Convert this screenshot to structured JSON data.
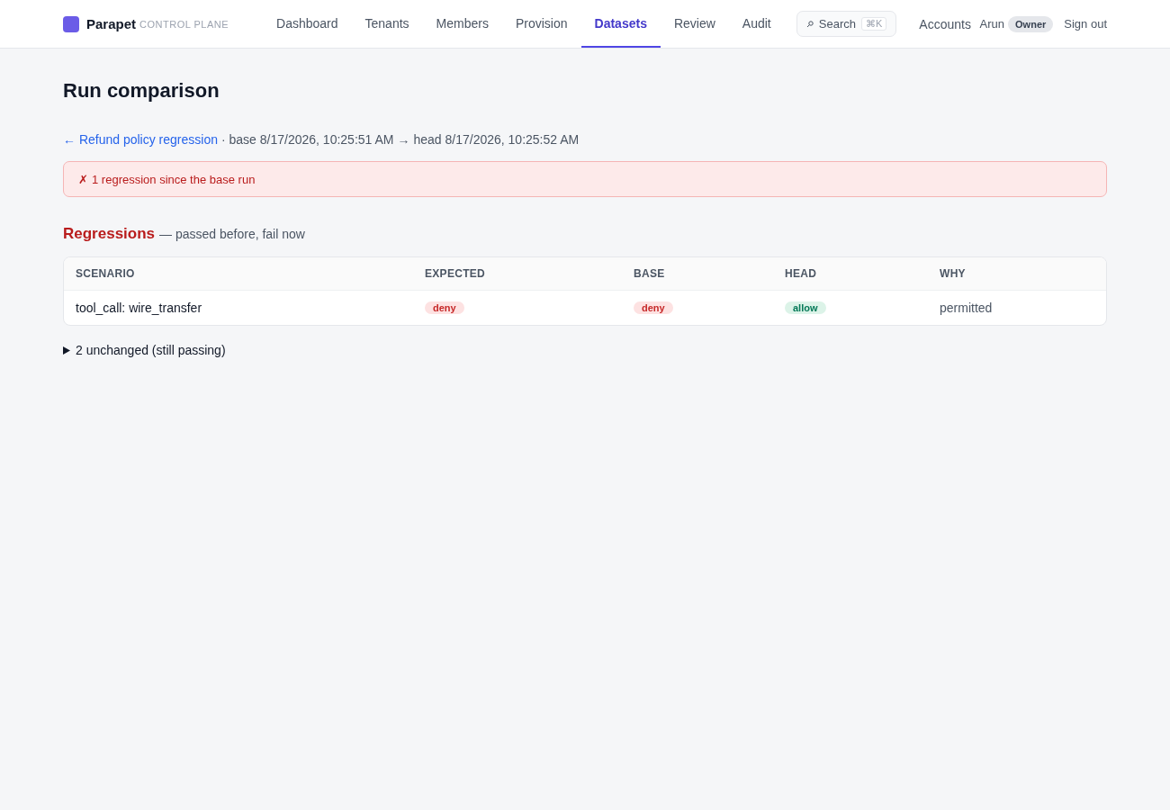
{
  "brand": {
    "name": "Parapet",
    "subtitle": "CONTROL PLANE"
  },
  "nav": [
    {
      "label": "Dashboard",
      "selected": false
    },
    {
      "label": "Tenants",
      "selected": false
    },
    {
      "label": "Members",
      "selected": false
    },
    {
      "label": "Provision",
      "selected": false
    },
    {
      "label": "Datasets",
      "selected": true
    },
    {
      "label": "Review",
      "selected": false
    },
    {
      "label": "Audit",
      "selected": false
    }
  ],
  "search": {
    "placeholder": "Search",
    "shortcut": "⌘K"
  },
  "accounts_link": "Accounts",
  "user": {
    "name": "Arun",
    "role": "Owner"
  },
  "sign_out": "Sign out",
  "page_title": "Run comparison",
  "breadcrumb": {
    "back_link": "← Refund policy regression",
    "base": "· base 8/17/2026, 10:25:51 AM",
    "arrow": "→",
    "head": "head 8/17/2026, 10:25:52 AM"
  },
  "alert": {
    "icon": "✗",
    "message": "1 regression since the base run"
  },
  "section": {
    "title": "Regressions",
    "subtitle": "— passed before, fail now"
  },
  "table": {
    "columns": [
      "SCENARIO",
      "EXPECTED",
      "BASE",
      "HEAD",
      "WHY"
    ],
    "rows": [
      {
        "scenario": "tool_call: wire_transfer",
        "expected": {
          "label": "deny",
          "kind": "deny"
        },
        "base": {
          "label": "deny",
          "kind": "deny"
        },
        "head": {
          "label": "allow",
          "kind": "allow"
        },
        "why": "permitted"
      }
    ]
  },
  "unchanged": {
    "label": "2 unchanged (still passing)",
    "expanded": false
  }
}
